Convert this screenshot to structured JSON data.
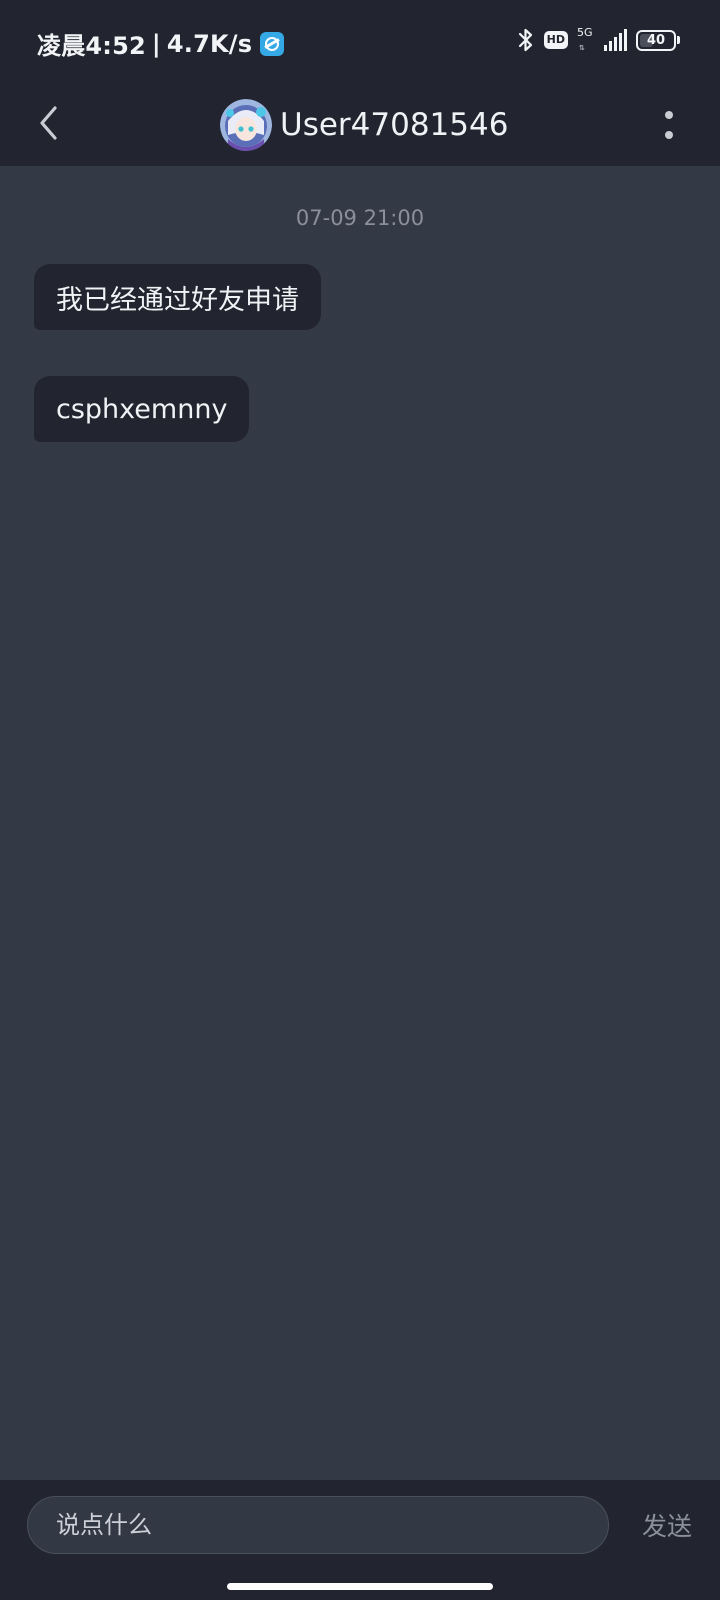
{
  "status_bar": {
    "time": "凌晨4:52",
    "separator": "|",
    "net_speed": "4.7K/s",
    "carrier_icon": "china-mobile-icon",
    "bluetooth_icon": "bluetooth-icon",
    "hd_label": "HD",
    "network_type": "5G",
    "signal_icon": "signal-strength-icon",
    "battery_level": "40"
  },
  "header": {
    "back_icon": "chevron-left-icon",
    "title": "User47081546",
    "avatar": "user-avatar",
    "more_icon": "more-vertical-icon"
  },
  "chat": {
    "timestamp": "07-09 21:00",
    "messages": [
      {
        "text": "我已经通过好友申请",
        "direction": "incoming"
      },
      {
        "text": "csphxemnny",
        "direction": "incoming"
      }
    ]
  },
  "composer": {
    "placeholder": "说点什么",
    "value": "",
    "send_label": "发送"
  },
  "colors": {
    "background": "#343946",
    "bar": "#22252f",
    "bubble": "#22252f",
    "muted_text": "#8a8f9b"
  }
}
